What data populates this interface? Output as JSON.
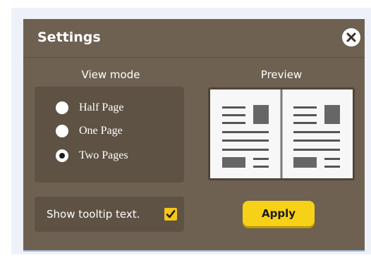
{
  "dialog": {
    "title": "Settings",
    "close_icon": "close-icon"
  },
  "view_mode": {
    "heading": "View mode",
    "options": [
      {
        "label": "Half Page",
        "selected": false
      },
      {
        "label": "One Page",
        "selected": false
      },
      {
        "label": "Two Pages",
        "selected": true
      }
    ]
  },
  "preview": {
    "heading": "Preview",
    "icon": "two-page-spread-icon"
  },
  "tooltip": {
    "label": "Show tooltip text.",
    "checked": true
  },
  "apply": {
    "label": "Apply"
  },
  "colors": {
    "dialog_bg": "#6e6151",
    "panel_bg": "#5e5244",
    "accent": "#f7d018"
  }
}
